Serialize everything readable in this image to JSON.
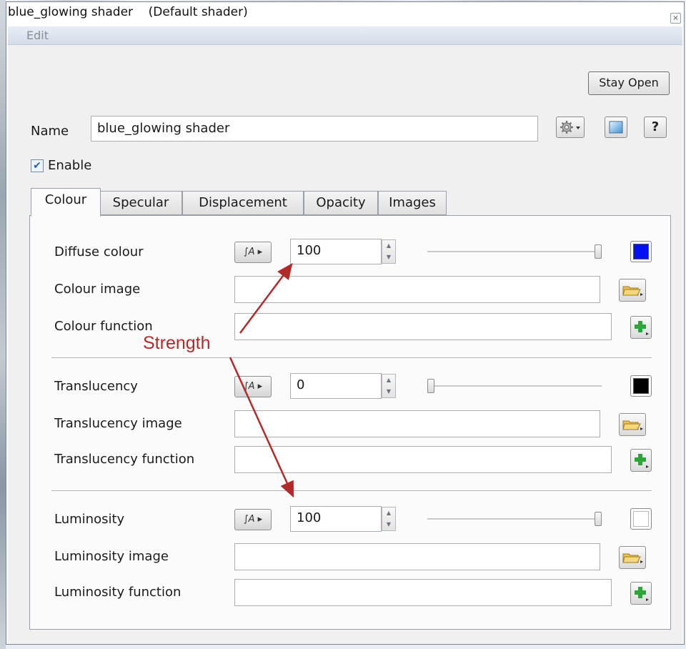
{
  "window": {
    "title": "blue_glowing shader    (Default shader)",
    "close_glyph": "×"
  },
  "menu": {
    "edit_label": "Edit"
  },
  "toolbar": {
    "stay_open_label": "Stay Open"
  },
  "name_row": {
    "label": "Name",
    "value": "blue_glowing shader",
    "gear_icon": "gear-icon",
    "preview_icon": "preview-icon",
    "help_label": "?"
  },
  "enable": {
    "label": "Enable",
    "checked": true
  },
  "tabs": [
    {
      "label": "Colour",
      "active": true
    },
    {
      "label": "Specular",
      "active": false
    },
    {
      "label": "Displacement",
      "active": false
    },
    {
      "label": "Opacity",
      "active": false
    },
    {
      "label": "Images",
      "active": false
    }
  ],
  "groups": [
    {
      "main_label": "Diffuse colour",
      "strength": "100",
      "slider_fraction": 1.0,
      "swatch_color": "#0010f0",
      "image_label": "Colour image",
      "function_label": "Colour function",
      "function_icon_label": "∫A"
    },
    {
      "main_label": "Translucency",
      "strength": "0",
      "slider_fraction": 0.0,
      "swatch_color": "#000000",
      "image_label": "Translucency image",
      "function_label": "Translucency function",
      "function_icon_label": "∫A"
    },
    {
      "main_label": "Luminosity",
      "strength": "100",
      "slider_fraction": 1.0,
      "swatch_color": "#ffffff",
      "image_label": "Luminosity image",
      "function_label": "Luminosity function",
      "function_icon_label": "∫A"
    }
  ],
  "annotation": {
    "text": "Strength",
    "color": "#b02b2b"
  }
}
